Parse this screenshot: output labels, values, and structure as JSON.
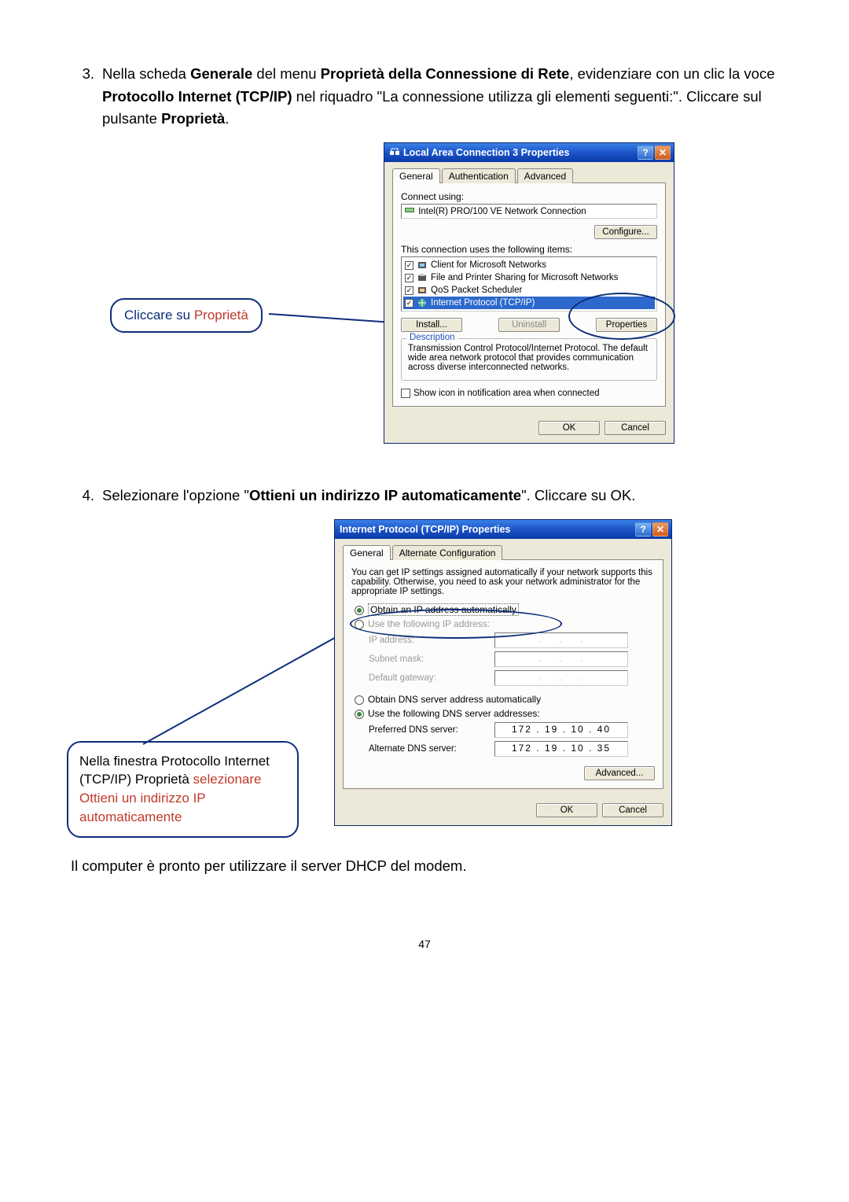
{
  "step3": {
    "number": "3.",
    "text_parts": {
      "p1": "Nella scheda ",
      "b1": "Generale",
      "p2": " del menu ",
      "b2": "Proprietà della Connessione di Rete",
      "p3": ", evidenziare con un clic la voce ",
      "b3": "Protocollo Internet    (TCP/IP)",
      "p4": " nel riquadro \"La connessione utilizza gli elementi seguenti:\". Cliccare sul pulsante ",
      "b4": "Proprietà",
      "p5": "."
    }
  },
  "callout1": {
    "prefix": "Cliccare su ",
    "red": "Proprietà"
  },
  "dialog1": {
    "title": "Local Area Connection 3 Properties",
    "tabs": {
      "general": "General",
      "auth": "Authentication",
      "adv": "Advanced"
    },
    "connect_using": "Connect using:",
    "adapter": "Intel(R) PRO/100 VE Network Connection",
    "configure": "Configure...",
    "uses_label": "This connection uses the following items:",
    "items": [
      {
        "label": "Client for Microsoft Networks"
      },
      {
        "label": "File and Printer Sharing for Microsoft Networks"
      },
      {
        "label": "QoS Packet Scheduler"
      },
      {
        "label": "Internet Protocol (TCP/IP)"
      }
    ],
    "install": "Install...",
    "uninstall": "Uninstall",
    "properties": "Properties",
    "desc_title": "Description",
    "desc_text": "Transmission Control Protocol/Internet Protocol. The default wide area network protocol that provides communication across diverse interconnected networks.",
    "show_icon": "Show icon in notification area when connected",
    "ok": "OK",
    "cancel": "Cancel"
  },
  "step4": {
    "number": "4.",
    "p1": "Selezionare l'opzione \"",
    "b1": "Ottieni un indirizzo IP automaticamente",
    "p2": "\". Cliccare su OK."
  },
  "callout2": {
    "line1": "Nella finestra Protocollo Internet",
    "line2a": "(TCP/IP) Proprietà ",
    "line2b_red": "selezionare",
    "line3_red": "Ottieni un indirizzo IP",
    "line4_red": "automaticamente"
  },
  "dialog2": {
    "title": "Internet Protocol (TCP/IP) Properties",
    "tabs": {
      "general": "General",
      "alt": "Alternate Configuration"
    },
    "info": "You can get IP settings assigned automatically if your network supports this capability. Otherwise, you need to ask your network administrator for the appropriate IP settings.",
    "obtain_ip": "Obtain an IP address automatically",
    "use_ip": "Use the following IP address:",
    "ip_label": "IP address:",
    "subnet_label": "Subnet mask:",
    "gateway_label": "Default gateway:",
    "obtain_dns": "Obtain DNS server address automatically",
    "use_dns": "Use the following DNS server addresses:",
    "pref_dns_label": "Preferred DNS server:",
    "pref_dns_val": "172 . 19 . 10 . 40",
    "alt_dns_label": "Alternate DNS server:",
    "alt_dns_val": "172 . 19 . 10 . 35",
    "advanced": "Advanced...",
    "ok": "OK",
    "cancel": "Cancel"
  },
  "final_text": "Il computer è pronto per utilizzare il server DHCP del modem.",
  "page_number": "47"
}
